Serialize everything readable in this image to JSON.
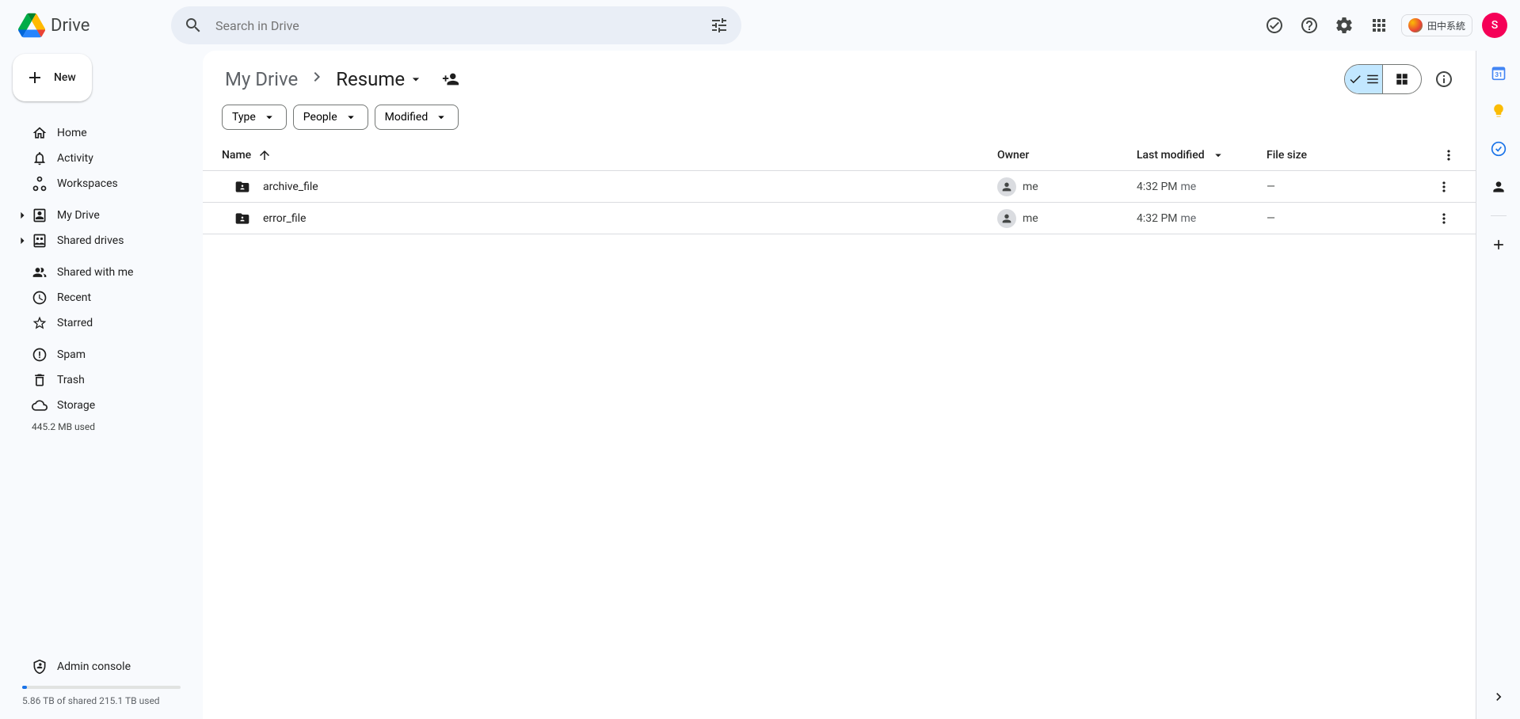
{
  "app": {
    "title": "Drive"
  },
  "search": {
    "placeholder": "Search in Drive"
  },
  "header": {
    "account_label": "田中系統",
    "avatar_letter": "S"
  },
  "sidebar": {
    "new_label": "New",
    "items": [
      {
        "id": "home",
        "label": "Home"
      },
      {
        "id": "activity",
        "label": "Activity"
      },
      {
        "id": "workspaces",
        "label": "Workspaces"
      }
    ],
    "drive_items": [
      {
        "id": "mydrive",
        "label": "My Drive"
      },
      {
        "id": "shareddrives",
        "label": "Shared drives"
      }
    ],
    "shared_items": [
      {
        "id": "sharedwithme",
        "label": "Shared with me"
      },
      {
        "id": "recent",
        "label": "Recent"
      },
      {
        "id": "starred",
        "label": "Starred"
      }
    ],
    "cleanup_items": [
      {
        "id": "spam",
        "label": "Spam"
      },
      {
        "id": "trash",
        "label": "Trash"
      },
      {
        "id": "storage",
        "label": "Storage"
      }
    ],
    "storage_used_text": "445.2 MB used",
    "admin_label": "Admin console",
    "shared_storage_text": "5.86 TB of shared 215.1 TB used"
  },
  "breadcrumb": {
    "root": "My Drive",
    "current": "Resume"
  },
  "filters": {
    "type": "Type",
    "people": "People",
    "modified": "Modified"
  },
  "table": {
    "columns": {
      "name": "Name",
      "owner": "Owner",
      "modified": "Last modified",
      "size": "File size"
    },
    "rows": [
      {
        "name": "archive_file",
        "owner": "me",
        "modified_time": "4:32 PM",
        "modified_by": "me",
        "size": "—"
      },
      {
        "name": "error_file",
        "owner": "me",
        "modified_time": "4:32 PM",
        "modified_by": "me",
        "size": "—"
      }
    ]
  }
}
